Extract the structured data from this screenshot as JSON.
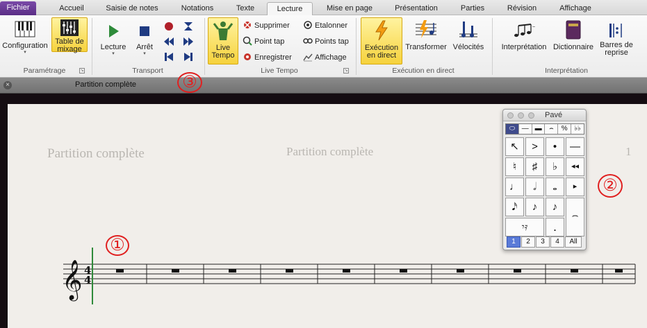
{
  "tabs": [
    {
      "label": "Fichier"
    },
    {
      "label": "Accueil"
    },
    {
      "label": "Saisie de notes"
    },
    {
      "label": "Notations"
    },
    {
      "label": "Texte"
    },
    {
      "label": "Lecture"
    },
    {
      "label": "Mise en page"
    },
    {
      "label": "Présentation"
    },
    {
      "label": "Parties"
    },
    {
      "label": "Révision"
    },
    {
      "label": "Affichage"
    }
  ],
  "active_tab": "Lecture",
  "ribbon": {
    "parametrage": {
      "title": "Paramétrage",
      "configuration": "Configuration",
      "table_line1": "Table de",
      "table_line2": "mixage"
    },
    "transport": {
      "title": "Transport",
      "lecture": "Lecture",
      "arret": "Arrêt"
    },
    "live_tempo": {
      "title": "Live Tempo",
      "live_line1": "Live",
      "live_line2": "Tempo",
      "supprimer": "Supprimer",
      "point_tap": "Point tap",
      "enregistrer": "Enregistrer",
      "etalonner": "Etalonner",
      "points_tap": "Points tap",
      "affichage": "Affichage"
    },
    "execution": {
      "title": "Exécution en direct",
      "exec_line1": "Exécution",
      "exec_line2": "en direct",
      "transformer": "Transformer",
      "velocites": "Vélocités"
    },
    "interpretation": {
      "title": "Interprétation",
      "interpretation": "Interprétation",
      "dictionnaire": "Dictionnaire",
      "barres_line1": "Barres de",
      "barres_line2": "reprise"
    }
  },
  "document": {
    "strip_title": "Partition complète",
    "header_left": "Partition complète",
    "header_center": "Partition complète",
    "page_number": "1"
  },
  "badges": {
    "one": "①",
    "two": "②",
    "three": "③"
  },
  "pave": {
    "title": "Pavé",
    "tabs": [
      "⬭",
      "—",
      "▬",
      "⌢",
      "%",
      "♭♭"
    ],
    "cells": [
      "↖",
      ">",
      "•",
      "—",
      "♮",
      "♯",
      "♭",
      "◂◂",
      "♩",
      "𝅗𝅥",
      "𝅝",
      "▸",
      "𝅘𝅥𝅯",
      "♪",
      "♪",
      "⌢",
      "𝄾𝄿",
      ".",
      "",
      ""
    ],
    "layers": [
      "1",
      "2",
      "3",
      "4",
      "All"
    ]
  },
  "colors": {
    "accent_purple": "#5b2e86",
    "highlight_yellow": "#f6d23c",
    "badge_red": "#e02020",
    "playback_line": "#2f8a3a"
  }
}
